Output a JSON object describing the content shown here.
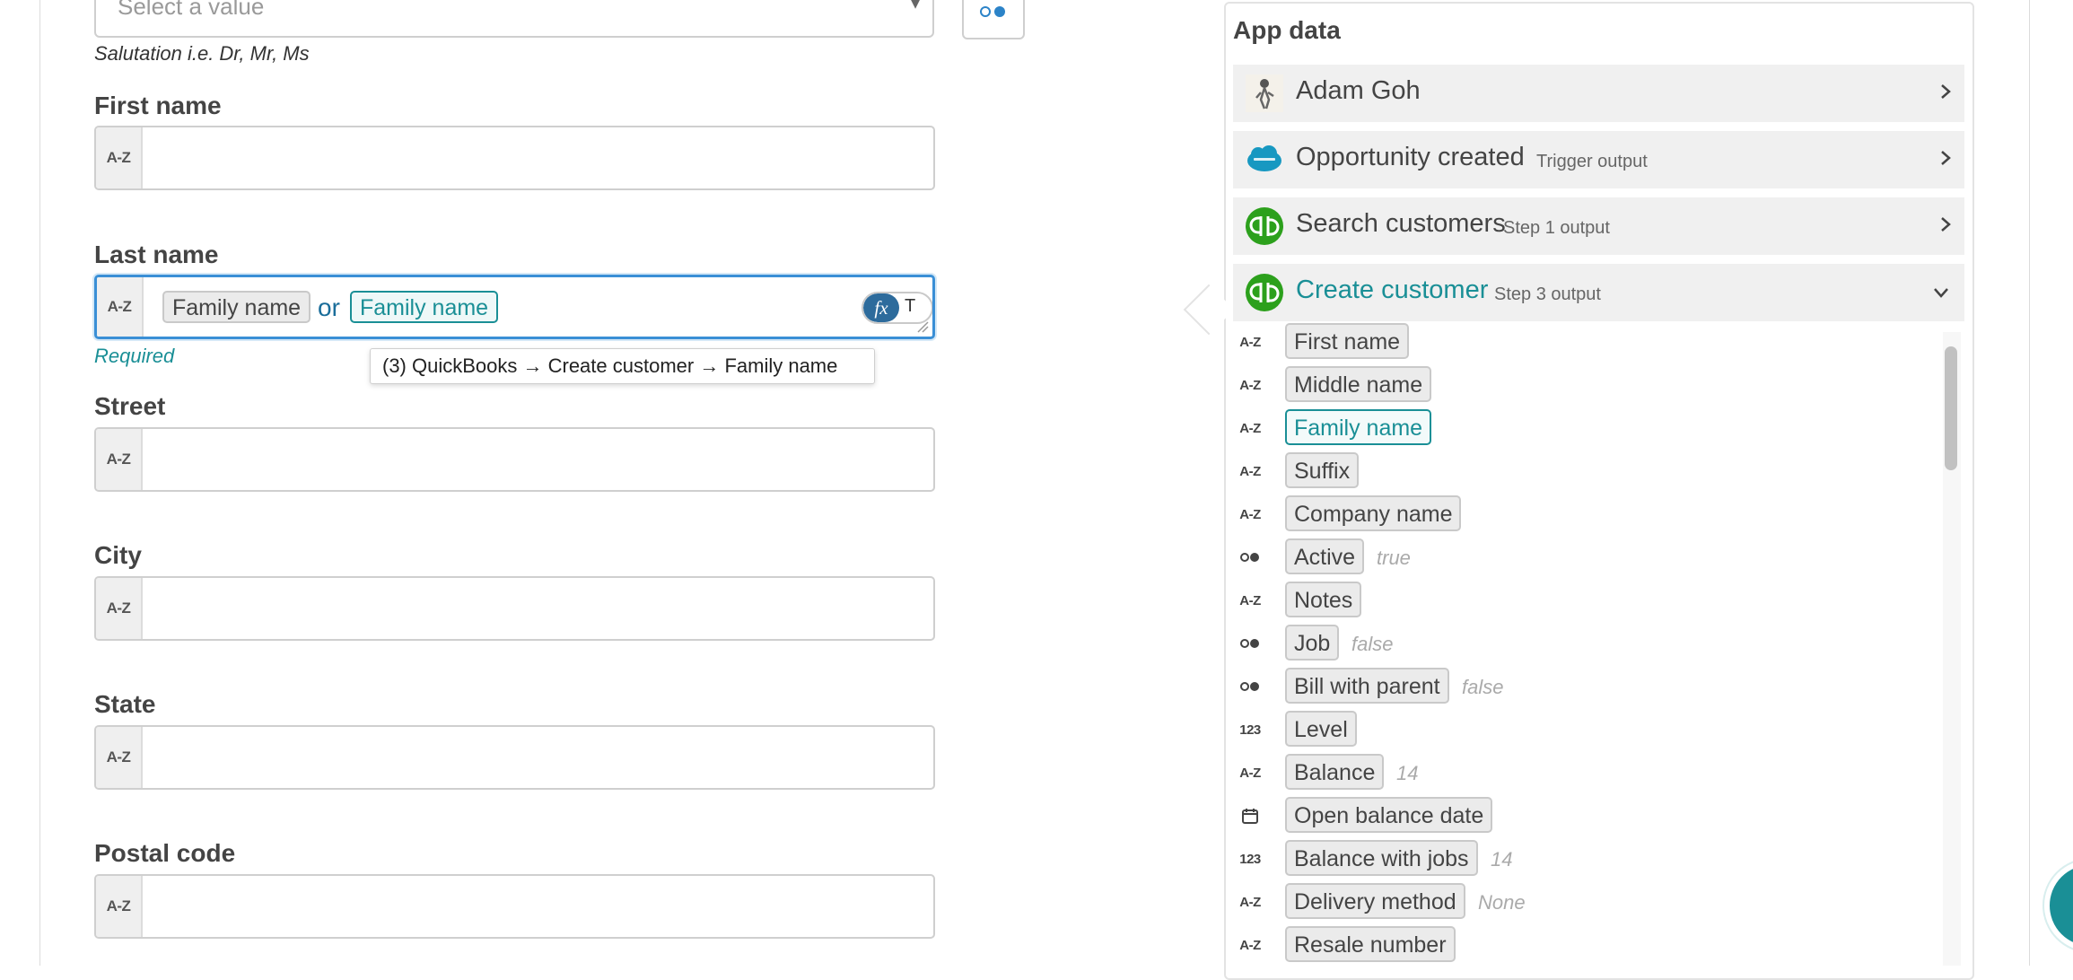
{
  "form": {
    "salutation": {
      "placeholder": "Select a value",
      "caret": "▾",
      "hint": "Salutation i.e. Dr, Mr, Ms"
    },
    "first_name": {
      "label": "First name",
      "type_badge": "A-Z"
    },
    "last_name": {
      "label": "Last name",
      "type_badge": "A-Z",
      "pill_1": "Family name",
      "connector": "or",
      "pill_2": "Family name",
      "mode_fx": "fx",
      "mode_text": "T",
      "hint": "Required"
    },
    "tooltip": "(3) QuickBooks → Create customer → Family name",
    "street": {
      "label": "Street",
      "type_badge": "A-Z"
    },
    "city": {
      "label": "City",
      "type_badge": "A-Z"
    },
    "state": {
      "label": "State",
      "type_badge": "A-Z"
    },
    "postal_code": {
      "label": "Postal code",
      "type_badge": "A-Z"
    }
  },
  "app_data": {
    "title": "App data",
    "steps": [
      {
        "name": "Adam Goh",
        "subtitle": "",
        "icon": "user-avatar-icon",
        "expanded": false
      },
      {
        "name": "Opportunity created",
        "subtitle": "Trigger output",
        "icon": "salesforce-icon",
        "expanded": false
      },
      {
        "name": "Search customers",
        "subtitle": "Step 1 output",
        "icon": "quickbooks-icon",
        "expanded": false
      },
      {
        "name": "Create customer",
        "subtitle": "Step 3 output",
        "icon": "quickbooks-icon",
        "expanded": true
      }
    ],
    "fields": [
      {
        "type": "A-Z",
        "label": "First name",
        "value": ""
      },
      {
        "type": "A-Z",
        "label": "Middle name",
        "value": ""
      },
      {
        "type": "A-Z",
        "label": "Family name",
        "value": "",
        "selected": true
      },
      {
        "type": "A-Z",
        "label": "Suffix",
        "value": ""
      },
      {
        "type": "A-Z",
        "label": "Company name",
        "value": ""
      },
      {
        "type": "boolean",
        "label": "Active",
        "value": "true"
      },
      {
        "type": "A-Z",
        "label": "Notes",
        "value": ""
      },
      {
        "type": "boolean",
        "label": "Job",
        "value": "false"
      },
      {
        "type": "boolean",
        "label": "Bill with parent",
        "value": "false"
      },
      {
        "type": "123",
        "label": "Level",
        "value": ""
      },
      {
        "type": "A-Z",
        "label": "Balance",
        "value": "14"
      },
      {
        "type": "date",
        "label": "Open balance date",
        "value": ""
      },
      {
        "type": "123",
        "label": "Balance with jobs",
        "value": "14"
      },
      {
        "type": "A-Z",
        "label": "Delivery method",
        "value": "None"
      },
      {
        "type": "A-Z",
        "label": "Resale number",
        "value": ""
      }
    ]
  },
  "colors": {
    "accent": "#1a8f96",
    "focus": "#3a8fd6",
    "fx_toggle": "#2d6b9c"
  }
}
